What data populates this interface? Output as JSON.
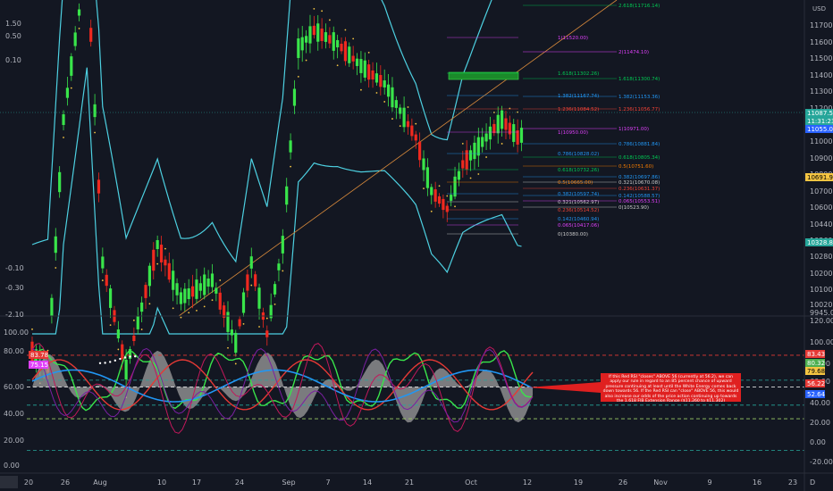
{
  "chart_data": [
    {
      "type": "candlestick",
      "currency": "USD",
      "left_axis_labels": [
        "1.50",
        "0.50",
        "0.10",
        "-0.10",
        "-0.30",
        "-2.10"
      ],
      "price_axis_labels": [
        "11700.00",
        "11600.00",
        "11500.00",
        "11400.00",
        "11300.00",
        "11200.00",
        "11100.00",
        "11000.00",
        "10900.00",
        "10800.00",
        "10700.00",
        "10600.00",
        "10440.00",
        "10360.00",
        "10280.00",
        "10200.00",
        "10100.00",
        "10020.00",
        "9945.00"
      ],
      "price_tags": [
        {
          "text": "11087.56",
          "color": "#26a69a"
        },
        {
          "text": "11:31:23",
          "color": "#26a69a"
        },
        {
          "text": "11055.02",
          "color": "#2962ff"
        },
        {
          "text": "10691.91",
          "color": "#f5c542"
        },
        {
          "text": "10328.81",
          "color": "#26a69a"
        }
      ],
      "fib_right": [
        {
          "text": "2.618(11716.14)",
          "color": "#00c853"
        },
        {
          "text": "1.618(11300.74)",
          "color": "#00c853"
        },
        {
          "text": "1.382(11153.36)",
          "color": "#2196f3"
        },
        {
          "text": "1.236(11056.77)",
          "color": "#f44336"
        },
        {
          "text": "0.786(10881.84)",
          "color": "#2196f3"
        },
        {
          "text": "0.618(10805.34)",
          "color": "#00c853"
        },
        {
          "text": "0.5(10751.60)",
          "color": "#f57c00"
        },
        {
          "text": "0.382(10697.86)",
          "color": "#2196f3"
        },
        {
          "text": "0.321(10670.08)",
          "color": "#cccccc"
        },
        {
          "text": "0.236(10631.37)",
          "color": "#f44336"
        },
        {
          "text": "0.142(10588.57)",
          "color": "#2196f3"
        },
        {
          "text": "0.065(10553.51)",
          "color": "#e040fb"
        },
        {
          "text": "0(10523.90)",
          "color": "#cccccc"
        }
      ],
      "fib_right_magenta": [
        {
          "text": "2(11474.10)",
          "color": "#e040fb"
        },
        {
          "text": "1(10971.00)",
          "color": "#e040fb"
        }
      ],
      "fib_mid": [
        {
          "text": "1(11520.00)",
          "color": "#e040fb"
        },
        {
          "text": "1.618(11302.26)",
          "color": "#00c853"
        },
        {
          "text": "1.382(11167.74)",
          "color": "#2196f3"
        },
        {
          "text": "1.236(11084.52)",
          "color": "#f44336"
        },
        {
          "text": "1(10950.00)",
          "color": "#e040fb"
        },
        {
          "text": "0.786(10828.02)",
          "color": "#2196f3"
        },
        {
          "text": "0.618(10732.26)",
          "color": "#00c853"
        },
        {
          "text": "0.5(10665.00)",
          "color": "#f57c00"
        },
        {
          "text": "0.382(10597.74)",
          "color": "#2196f3"
        },
        {
          "text": "0.321(10562.97)",
          "color": "#cccccc"
        },
        {
          "text": "0.236(10514.52)",
          "color": "#f44336"
        },
        {
          "text": "0.142(10460.94)",
          "color": "#2196f3"
        },
        {
          "text": "0.065(10417.06)",
          "color": "#e040fb"
        },
        {
          "text": "0(10380.00)",
          "color": "#cccccc"
        }
      ]
    },
    {
      "type": "line",
      "left_axis_labels": [
        "100.00",
        "80.00",
        "60.00",
        "40.00",
        "20.00",
        "0.00"
      ],
      "right_axis_labels": [
        "120.00",
        "100.00",
        "80.00",
        "60.00",
        "40.00",
        "20.00",
        "0.00",
        "-20.00"
      ],
      "tags_left": [
        {
          "text": "83.78",
          "color": "#e53935"
        },
        {
          "text": "75.15",
          "color": "#e040fb"
        }
      ],
      "tags_right": [
        {
          "text": "83.43",
          "color": "#e53935"
        },
        {
          "text": "80.32",
          "color": "#4caf50"
        },
        {
          "text": "79.68",
          "color": "#f5c542"
        },
        {
          "text": "56.22",
          "color": "#e53935"
        },
        {
          "text": "52.64",
          "color": "#2962ff"
        }
      ]
    }
  ],
  "x_axis_labels": [
    "20",
    "26",
    "Aug",
    "10",
    "17",
    "24",
    "Sep",
    "7",
    "14",
    "21",
    "Oct",
    "12",
    "19",
    "26",
    "Nov",
    "9",
    "16",
    "23"
  ],
  "annotation": "If this Red RSI \"closes\" ABOVE 56 (currently at 56.2), we can apply our rule in regard to an 85 percent chance of upward pressure continuing at least until the White Energy comes back down towards 56. If the Red RSI can \"close\" ABOVE 56, this would also increase our odds of the price action continuing up towards the 1.618 FIB Extension Range ($11,260 to $11,302)",
  "corner_label": "D",
  "colors": {
    "background": "#131722",
    "bull": "#39e54a",
    "bear": "#f0291f",
    "band": "#4dd0e1"
  }
}
